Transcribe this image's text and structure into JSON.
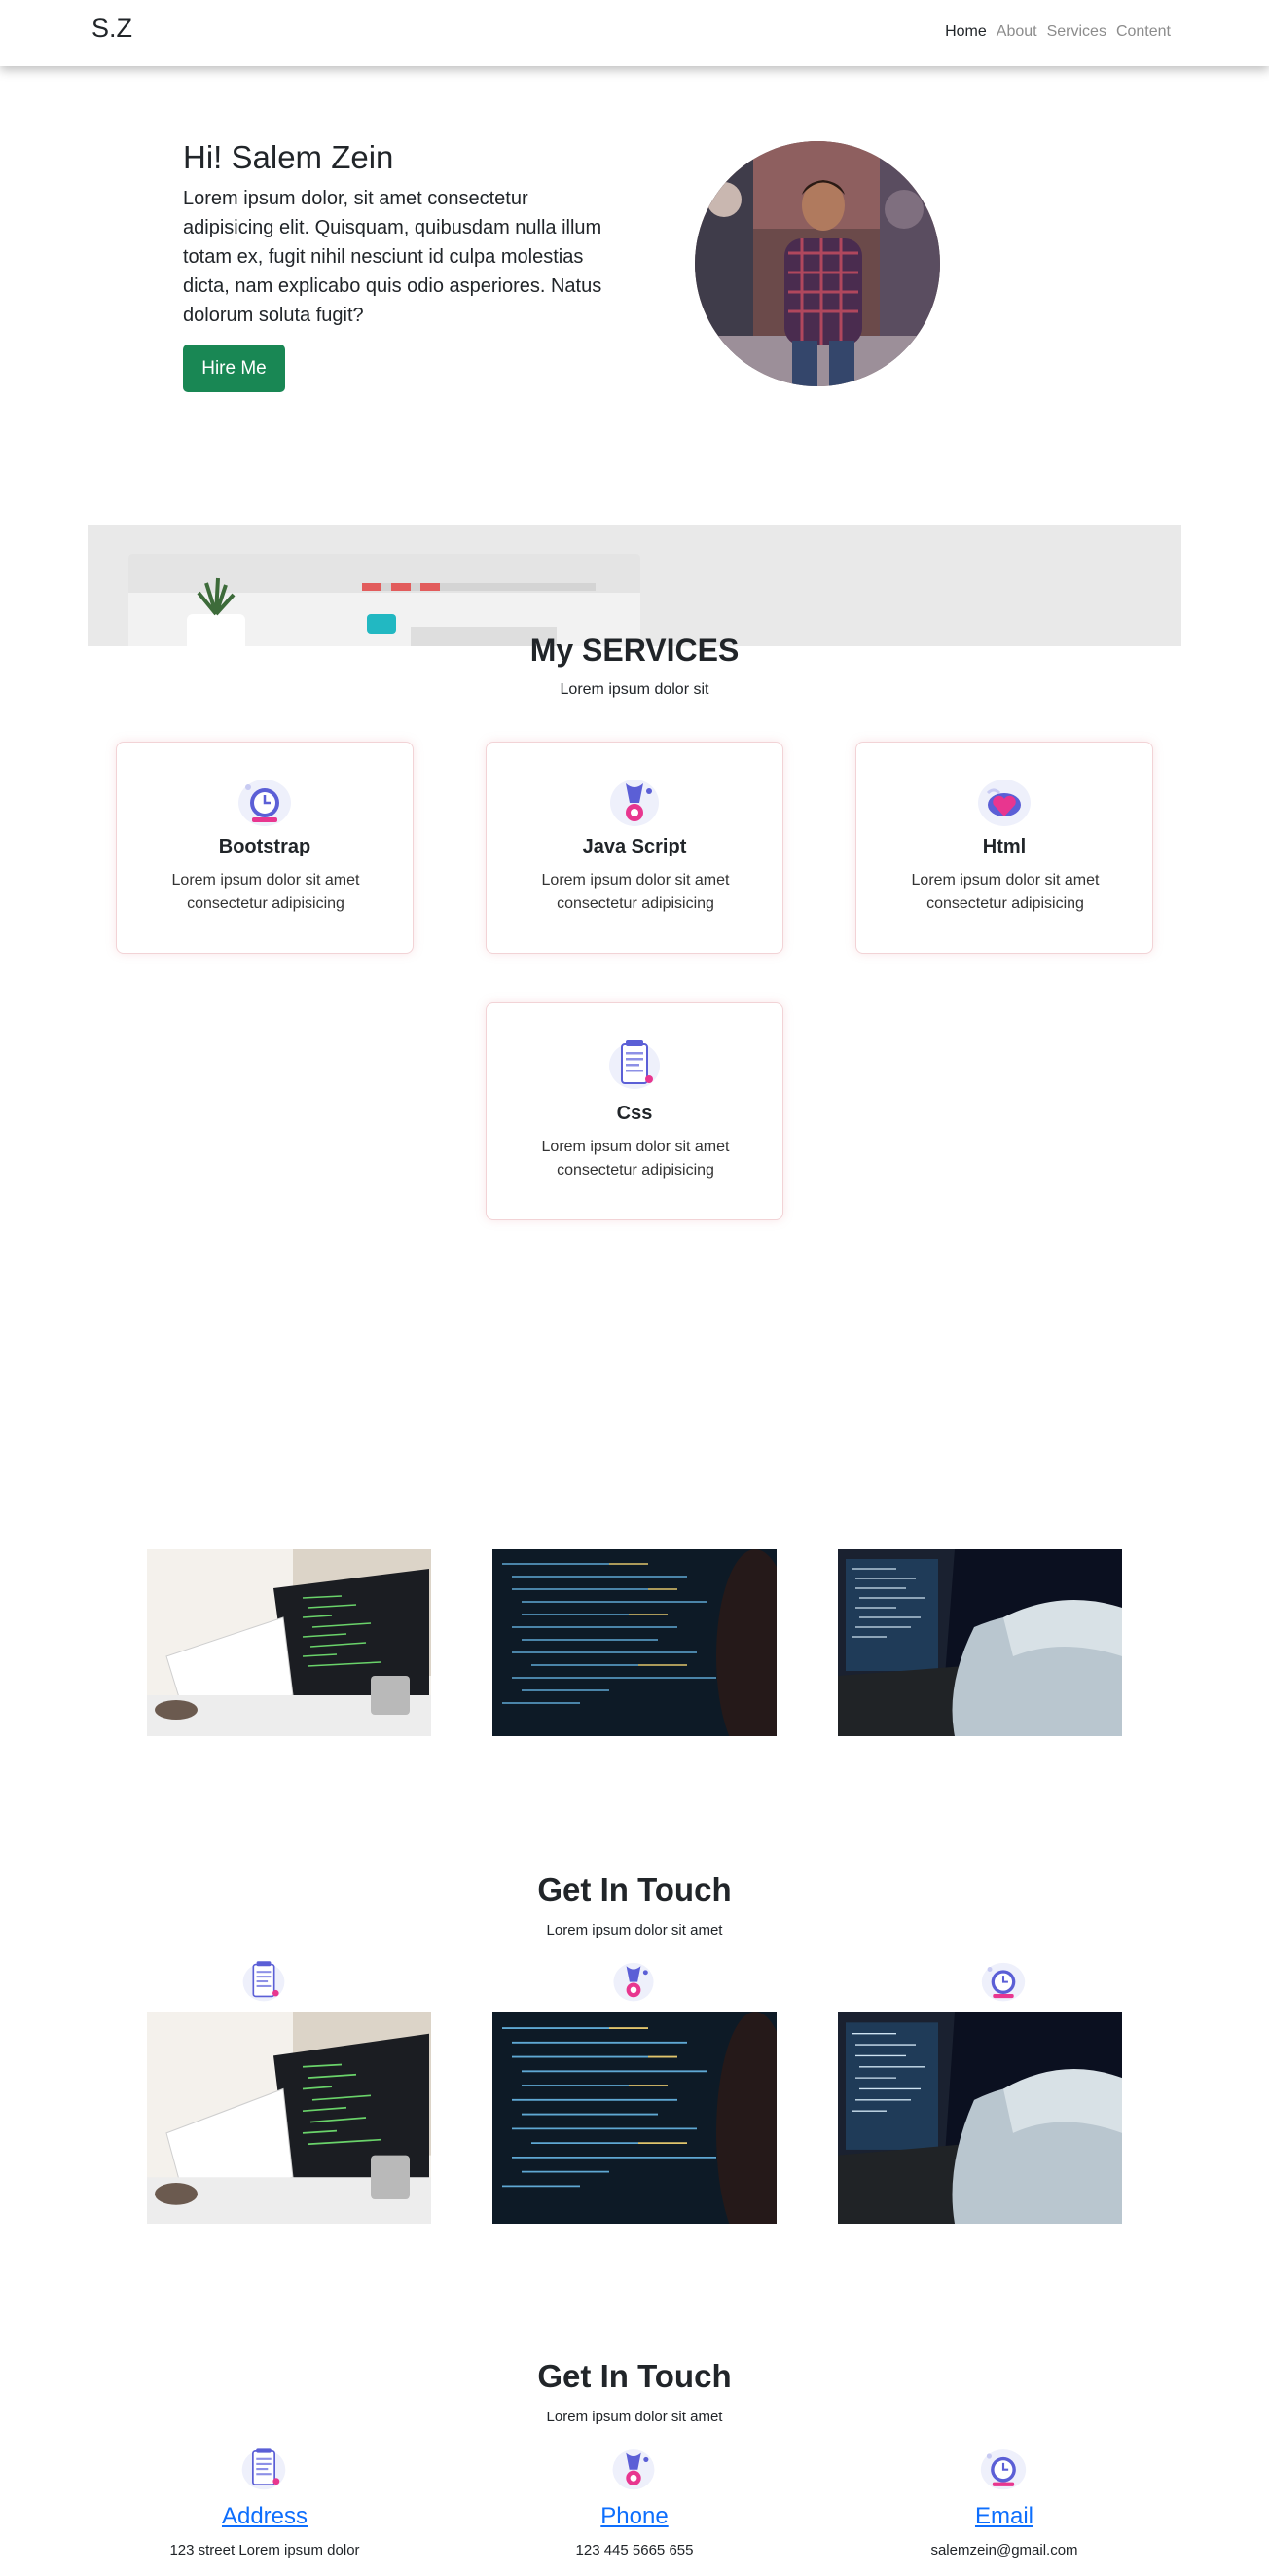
{
  "nav": {
    "brand": "S.Z",
    "links": [
      "Home",
      "About",
      "Services",
      "Content"
    ]
  },
  "hero": {
    "title": "Hi! Salem Zein",
    "text": "Lorem ipsum dolor, sit amet consectetur adipisicing elit. Quisquam, quibusdam nulla illum totam ex, fugit nihil nesciunt id culpa molestias dicta, nam explicabo quis odio asperiores. Natus dolorum soluta fugit?",
    "button": "Hire Me"
  },
  "services": {
    "title": "My SERVICES",
    "subtitle": "Lorem ipsum dolor sit",
    "cards": [
      {
        "title": "Bootstrap",
        "text": "Lorem ipsum dolor sit amet consectetur adipisicing",
        "icon": "clock-icon"
      },
      {
        "title": "Java Script",
        "text": "Lorem ipsum dolor sit amet consectetur adipisicing",
        "icon": "wrench-icon"
      },
      {
        "title": "Html",
        "text": "Lorem ipsum dolor sit amet consectetur adipisicing",
        "icon": "heart-icon"
      },
      {
        "title": "Css",
        "text": "Lorem ipsum dolor sit amet consectetur adipisicing",
        "icon": "document-icon"
      }
    ]
  },
  "touch1": {
    "title": "Get In Touch",
    "subtitle": "Lorem ipsum dolor sit amet"
  },
  "touch2": {
    "title": "Get In Touch",
    "subtitle": "Lorem ipsum dolor sit amet",
    "items": [
      {
        "label": "Address",
        "value": "123 street Lorem ipsum dolor",
        "icon": "document-icon"
      },
      {
        "label": "Phone",
        "value": "123 445 5665 655",
        "icon": "wrench-icon"
      },
      {
        "label": "Email",
        "value": "salemzein@gmail.com",
        "icon": "clock-icon"
      }
    ]
  },
  "colors": {
    "accent_green": "#198754",
    "link_blue": "#0d6efd",
    "banner_gray": "#e9e9e9",
    "card_border": "#f2d3d6"
  }
}
